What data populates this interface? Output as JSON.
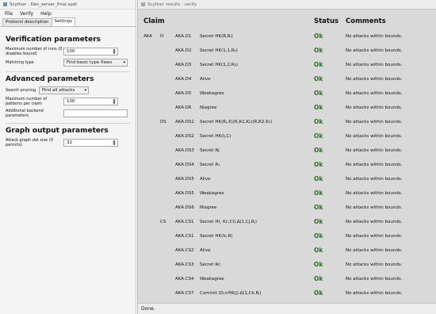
{
  "main_window": {
    "title": "Scyther - Des_server_final.spdl",
    "menu": [
      "File",
      "Verify",
      "Help"
    ],
    "tabs": [
      "Protocol description",
      "Settings"
    ],
    "active_tab": "Settings"
  },
  "settings": {
    "verification": {
      "title": "Verification parameters",
      "max_runs_label": "Maximum number of runs (0 disables bound)",
      "max_runs_value": "100",
      "matching_label": "Matching type",
      "matching_value": "Find basic type flaws"
    },
    "advanced": {
      "title": "Advanced parameters",
      "pruning_label": "Search pruning",
      "pruning_value": "Find all attacks",
      "max_patterns_label": "Maximum number of patterns per claim",
      "max_patterns_value": "100",
      "backend_label": "Additional backend parameters",
      "backend_value": ""
    },
    "graph": {
      "title": "Graph output parameters",
      "dot_size_label": "Attack graph dot size (0 permits)",
      "dot_size_value": "32"
    }
  },
  "results_window": {
    "title": "Scyther results : verify",
    "headers": {
      "claim": "Claim",
      "status": "Status",
      "comments": "Comments"
    },
    "status_bar": "Done.",
    "rows": [
      {
        "proto": "AKA",
        "role": "D",
        "id": "AKA.D1",
        "claim": "Secret HK(R,Rᵢ)",
        "status": "Ok",
        "comment": "No attacks within bounds."
      },
      {
        "proto": "",
        "role": "",
        "id": "AKA.D2",
        "claim": "Secret HK(1,1,R₄)",
        "status": "Ok",
        "comment": "No attacks within bounds."
      },
      {
        "proto": "",
        "role": "",
        "id": "AKA.D3",
        "claim": "Secret HK(1,2,R₃)",
        "status": "Ok",
        "comment": "No attacks within bounds."
      },
      {
        "proto": "",
        "role": "",
        "id": "AKA.D4",
        "claim": "Alive",
        "status": "Ok",
        "comment": "No attacks within bounds."
      },
      {
        "proto": "",
        "role": "",
        "id": "AKA.D5",
        "claim": "Weakagree",
        "status": "Ok",
        "comment": "No attacks within bounds."
      },
      {
        "proto": "",
        "role": "",
        "id": "AKA.D6",
        "claim": "Niagree",
        "status": "Ok",
        "comment": "No attacks within bounds."
      },
      {
        "proto": "",
        "role": "DS",
        "id": "AKA.DS1",
        "claim": "Secret HK(Rⱼ,X)(R,R1,K₂)(R,R2,K₃)",
        "status": "Ok",
        "comment": "No attacks within bounds."
      },
      {
        "proto": "",
        "role": "",
        "id": "AKA.DS2",
        "claim": "Secret HK(Iⱼ,C)",
        "status": "Ok",
        "comment": "No attacks within bounds."
      },
      {
        "proto": "",
        "role": "",
        "id": "AKA.DS3",
        "claim": "Secret Rj",
        "status": "Ok",
        "comment": "No attacks within bounds."
      },
      {
        "proto": "",
        "role": "",
        "id": "AKA.DS4",
        "claim": "Secret R₁",
        "status": "Ok",
        "comment": "No attacks within bounds."
      },
      {
        "proto": "",
        "role": "",
        "id": "AKA.DS5",
        "claim": "Alive",
        "status": "Ok",
        "comment": "No attacks within bounds."
      },
      {
        "proto": "",
        "role": "",
        "id": "AKA.DS5",
        "claim": "Weakagree",
        "status": "Ok",
        "comment": "No attacks within bounds."
      },
      {
        "proto": "",
        "role": "",
        "id": "AKA.DS6",
        "claim": "Niagree",
        "status": "Ok",
        "comment": "No attacks within bounds."
      },
      {
        "proto": "",
        "role": "CS",
        "id": "AKA.CS1",
        "claim": "Secret H(, Kc,CI).∆(1,Cj,Rⱼ)",
        "status": "Ok",
        "comment": "No attacks within bounds."
      },
      {
        "proto": "",
        "role": "",
        "id": "AKA.CS1",
        "claim": "Secret HK(Ic,R)",
        "status": "Ok",
        "comment": "No attacks within bounds."
      },
      {
        "proto": "",
        "role": "",
        "id": "AKA.CS2",
        "claim": "Alive",
        "status": "Ok",
        "comment": "No attacks within bounds."
      },
      {
        "proto": "",
        "role": "",
        "id": "AKA.CS3",
        "claim": "Secret Rc",
        "status": "Ok",
        "comment": "No attacks within bounds."
      },
      {
        "proto": "",
        "role": "",
        "id": "AKA.CS4",
        "claim": "Weakagree",
        "status": "Ok",
        "comment": "No attacks within bounds."
      },
      {
        "proto": "",
        "role": "",
        "id": "AKA.CS7",
        "claim": "Commit (Dⱼ+HK(j).∆(1,Ck,Rⱼ)",
        "status": "Ok",
        "comment": "No attacks within bounds."
      }
    ]
  },
  "colors": {
    "ok": "#1c7a1c",
    "results_bg": "#d9d9d9",
    "panel_bg": "#f4f4f4"
  }
}
